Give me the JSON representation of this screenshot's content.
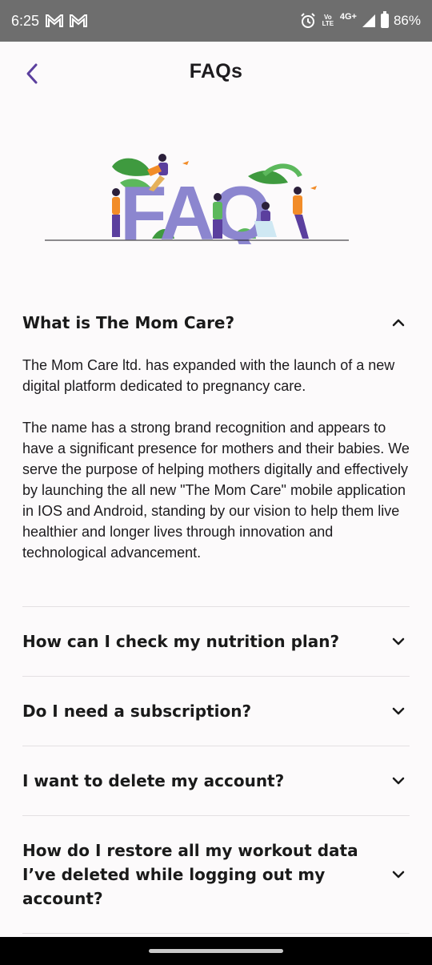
{
  "status_bar": {
    "time": "6:25",
    "network": "4G+",
    "volte": "Vo LTE",
    "battery": "86%"
  },
  "header": {
    "title": "FAQs"
  },
  "hero": {
    "letters": "FAQ",
    "colors": {
      "letters": "#8c86cf",
      "leaf": "#3f9a3f",
      "accent": "#f28c28",
      "purple": "#5b3f9e"
    }
  },
  "faqs": [
    {
      "question": "What is The Mom Care?",
      "expanded": true,
      "answer": "The Mom Care ltd. has expanded with the launch of a new digital platform dedicated to pregnancy care.\n\nThe name has a strong brand recognition and appears to have a significant presence for mothers and their babies. We serve the purpose of helping mothers digitally and effectively by launching the all new \"The Mom Care\" mobile application in IOS and Android, standing by our vision to help them live healthier and longer lives through innovation and technological advancement."
    },
    {
      "question": "How can I check my nutrition plan?",
      "expanded": false
    },
    {
      "question": "Do I need a subscription?",
      "expanded": false
    },
    {
      "question": "I want to delete my account?",
      "expanded": false
    },
    {
      "question": "How do I restore all my workout data I’ve deleted while logging out my account?",
      "expanded": false
    }
  ],
  "theme": {
    "accent": "#5b3f9e",
    "divider": "#e3e0e2"
  }
}
